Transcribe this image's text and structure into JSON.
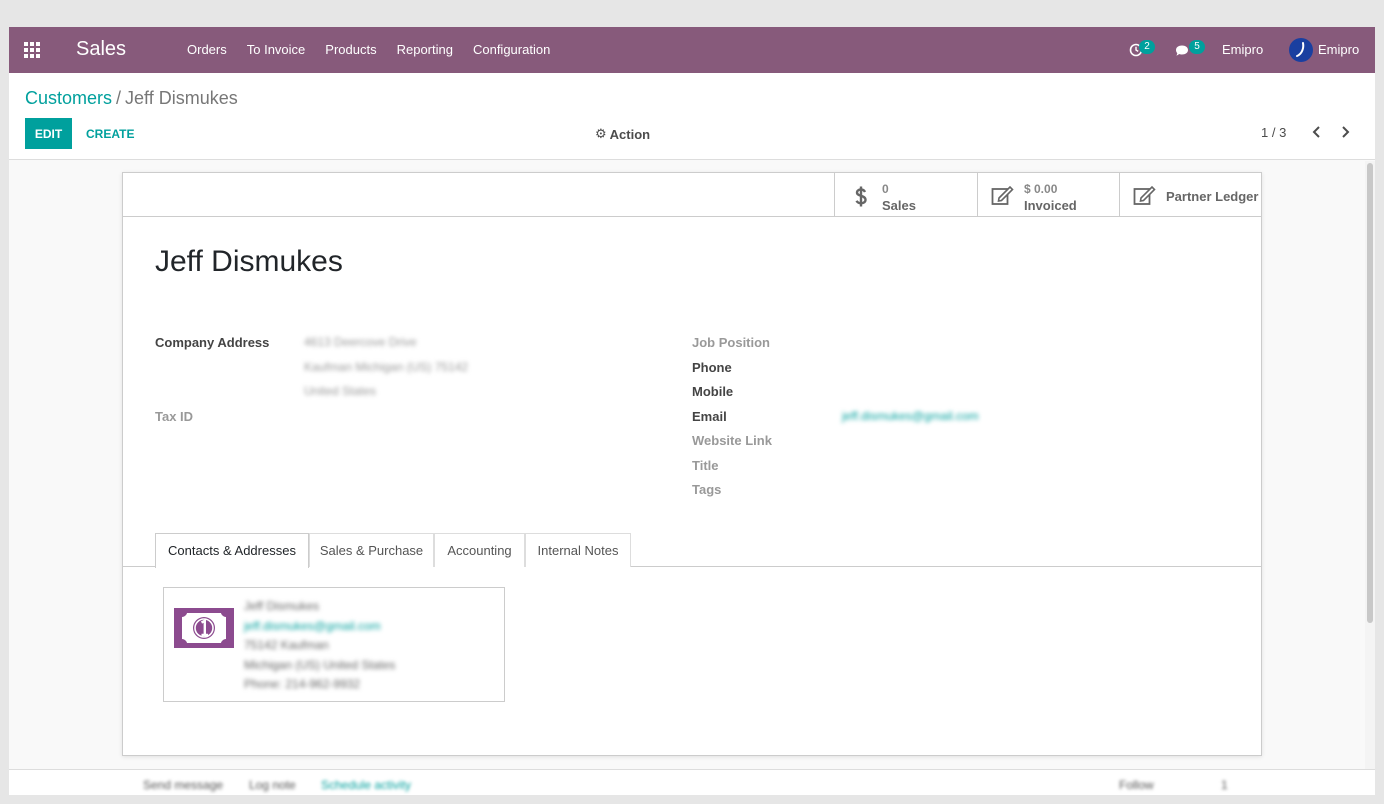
{
  "navbar": {
    "app_name": "Sales",
    "menu": [
      "Orders",
      "To Invoice",
      "Products",
      "Reporting",
      "Configuration"
    ],
    "activity_count": "2",
    "message_count": "5",
    "company": "Emipro",
    "user": "Emipro"
  },
  "breadcrumb": {
    "parent": "Customers",
    "separator": "/",
    "current": "Jeff Dismukes"
  },
  "control": {
    "edit_label": "EDIT",
    "create_label": "CREATE",
    "action_label": "Action",
    "pager": "1 / 3"
  },
  "smart_buttons": {
    "sales_value": "0",
    "sales_label": "Sales",
    "invoiced_value": "$ 0.00",
    "invoiced_label": "Invoiced",
    "ledger_label": "Partner Ledger"
  },
  "partner": {
    "name": "Jeff Dismukes",
    "street": "4613 Deercove Drive",
    "city_line": "Kaufman  Michigan (US)  75142",
    "country": "United States",
    "email": "jeff.dismukes@gmail.com"
  },
  "labels": {
    "company_address": "Company Address",
    "tax_id": "Tax ID",
    "job_position": "Job Position",
    "phone": "Phone",
    "mobile": "Mobile",
    "email": "Email",
    "website": "Website Link",
    "title": "Title",
    "tags": "Tags"
  },
  "tabs": [
    "Contacts & Addresses",
    "Sales & Purchase",
    "Accounting",
    "Internal Notes"
  ],
  "contact_card": {
    "name": "Jeff Dismukes",
    "email": "jeff.dismukes@gmail.com",
    "line1": "75142 Kaufman",
    "line2": "Michigan (US) United States",
    "phone": "Phone: 214-962-9932"
  },
  "chatter": {
    "send_message": "Send message",
    "log_note": "Log note",
    "schedule": "Schedule activity",
    "follow": "Follow",
    "followers": "1"
  },
  "colors": {
    "navbar": "#875a7b",
    "primary": "#00a09d"
  }
}
